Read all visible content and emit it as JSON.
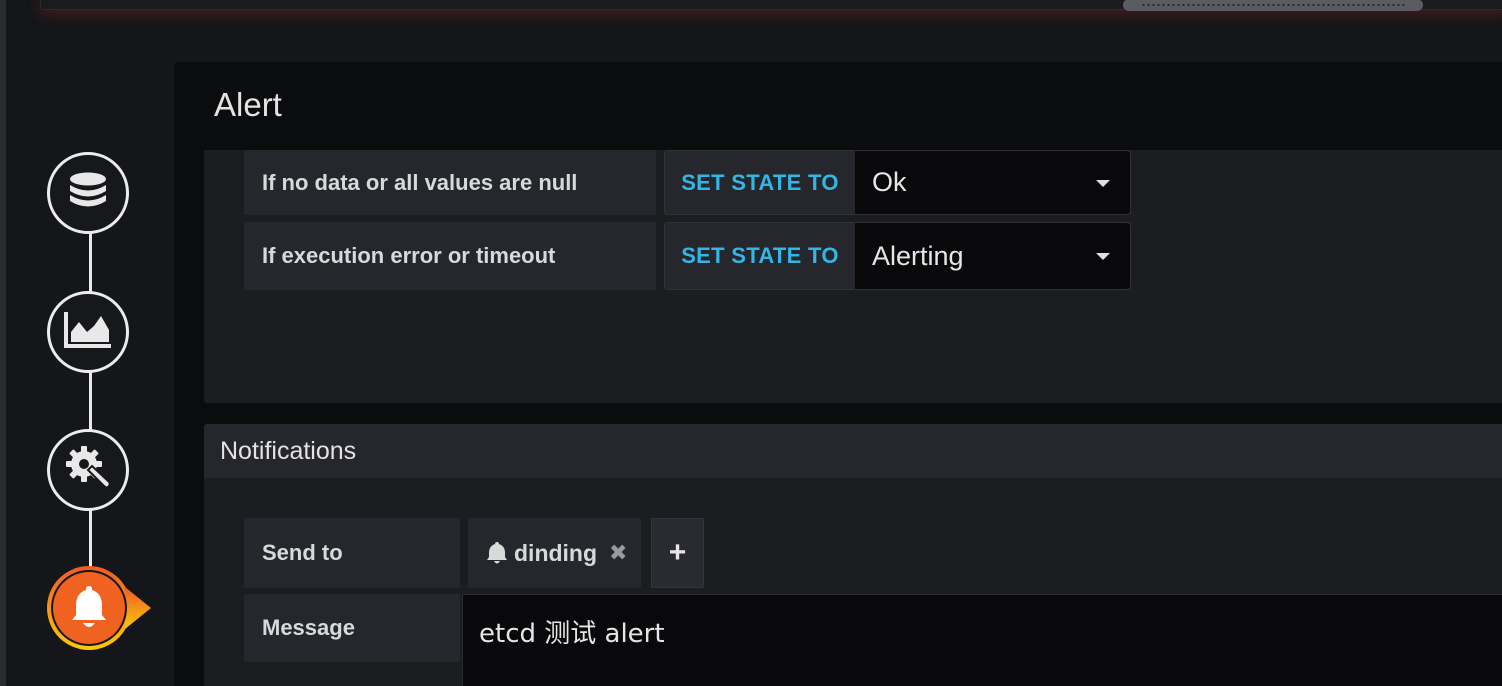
{
  "panel": {
    "title": "Alert"
  },
  "nav": {
    "steps": [
      {
        "name": "queries",
        "icon": "database-icon"
      },
      {
        "name": "visualization",
        "icon": "area-chart-icon"
      },
      {
        "name": "general",
        "icon": "gear-wrench-icon"
      },
      {
        "name": "alert",
        "icon": "bell-icon",
        "active": true
      }
    ],
    "active_color": "#f05a28"
  },
  "no_data_row": {
    "label": "If no data or all values are null",
    "state_label": "SET STATE TO",
    "value": "Ok"
  },
  "exec_error_row": {
    "label": "If execution error or timeout",
    "state_label": "SET STATE TO",
    "value": "Alerting"
  },
  "notifications": {
    "title": "Notifications",
    "send_to_label": "Send to",
    "channels": [
      {
        "name": "dinding",
        "icon": "bell-icon"
      }
    ],
    "remove_symbol": "✖",
    "add_symbol": "+",
    "message_label": "Message",
    "message_value": "etcd 测试 alert"
  },
  "colors": {
    "accent_blue": "#33b5e5",
    "alert_orange": "#f05a28",
    "alert_yellow": "#fbca0a"
  }
}
